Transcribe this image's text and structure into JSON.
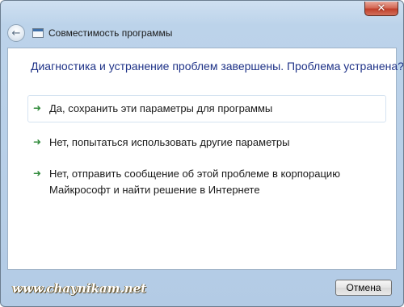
{
  "window": {
    "title": "Совместимость программы",
    "close_glyph": "✕",
    "back_glyph": "←"
  },
  "content": {
    "heading": "Диагностика и устранение проблем завершены. Проблема устранена?",
    "options": [
      {
        "label": "Да, сохранить эти параметры для программы"
      },
      {
        "label": "Нет, попытаться использовать другие параметры"
      },
      {
        "label": "Нет, отправить сообщение об этой проблеме в корпорацию Майкрософт и найти решение в Интернете"
      }
    ],
    "arrow_glyph": "➜"
  },
  "footer": {
    "watermark": "www.chaynikam.net",
    "cancel_label": "Отмена"
  },
  "colors": {
    "heading": "#1e3287",
    "arrow": "#2f8a3a",
    "frame": "#b3cbe5"
  },
  "icons": [
    "back-arrow-icon",
    "program-compatibility-icon",
    "close-icon",
    "green-arrow-icon"
  ]
}
